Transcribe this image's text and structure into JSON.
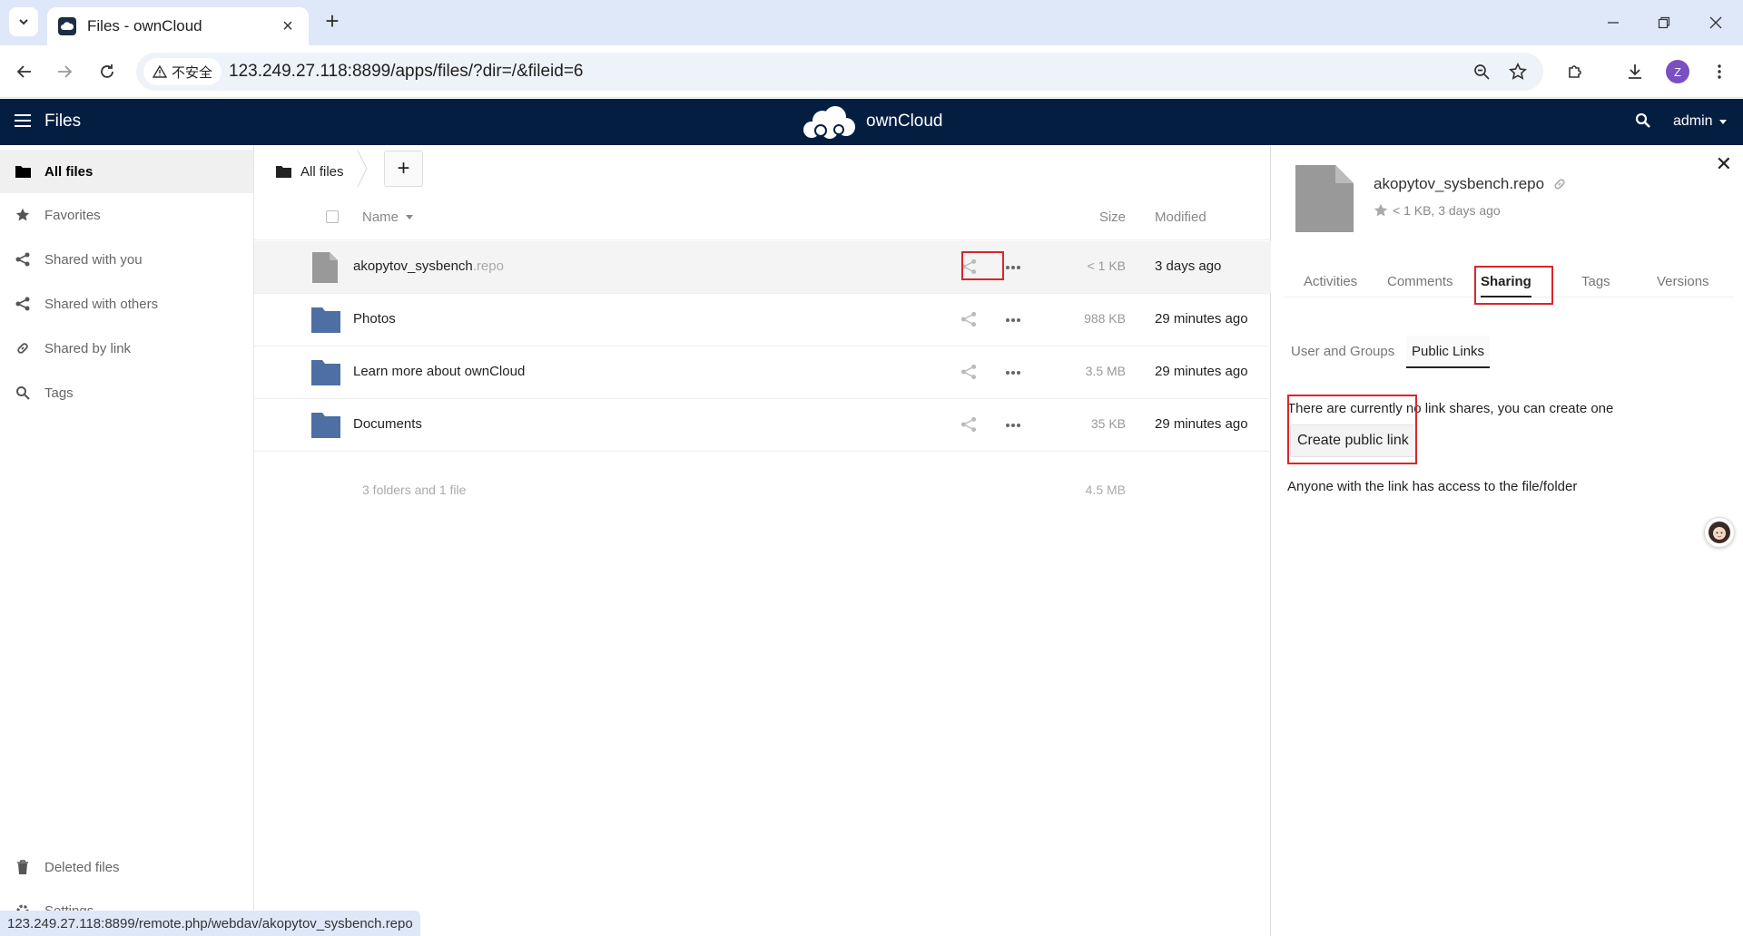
{
  "browser": {
    "tab_title": "Files - ownCloud",
    "security_label": "不安全",
    "url": "123.249.27.118:8899/apps/files/?dir=/&fileid=6",
    "profile_initial": "Z",
    "status_url": "123.249.27.118:8899/remote.php/webdav/akopytov_sysbench.repo"
  },
  "header": {
    "app_name": "Files",
    "brand": "ownCloud",
    "user": "admin"
  },
  "nav": {
    "items": [
      {
        "label": "All files",
        "icon": "folder-icon",
        "active": true
      },
      {
        "label": "Favorites",
        "icon": "star-icon"
      },
      {
        "label": "Shared with you",
        "icon": "share-icon"
      },
      {
        "label": "Shared with others",
        "icon": "share-icon"
      },
      {
        "label": "Shared by link",
        "icon": "link-icon"
      },
      {
        "label": "Tags",
        "icon": "search-icon"
      }
    ],
    "deleted_files": "Deleted files",
    "settings": "Settings"
  },
  "files": {
    "breadcrumb": "All files",
    "columns": {
      "name": "Name",
      "size": "Size",
      "modified": "Modified"
    },
    "rows": [
      {
        "name": "akopytov_sysbench",
        "ext": ".repo",
        "type": "file",
        "size": "< 1 KB",
        "modified": "3 days ago"
      },
      {
        "name": "Photos",
        "ext": "",
        "type": "folder",
        "size": "988 KB",
        "modified": "29 minutes ago"
      },
      {
        "name": "Learn more about ownCloud",
        "ext": "",
        "type": "folder",
        "size": "3.5 MB",
        "modified": "29 minutes ago"
      },
      {
        "name": "Documents",
        "ext": "",
        "type": "folder",
        "size": "35 KB",
        "modified": "29 minutes ago"
      }
    ],
    "summary_text": "3 folders and 1 file",
    "summary_size": "4.5 MB"
  },
  "details": {
    "filename": "akopytov_sysbench.repo",
    "meta": "< 1 KB, 3 days ago",
    "tabs": [
      "Activities",
      "Comments",
      "Sharing",
      "Tags",
      "Versions"
    ],
    "active_tab": "Sharing",
    "sub_tabs": [
      "User and Groups",
      "Public Links"
    ],
    "active_sub_tab": "Public Links",
    "no_links_text": "There are currently no link shares, you can create one",
    "create_button": "Create public link",
    "anyone_text": "Anyone with the link has access to the file/folder"
  },
  "colors": {
    "header_bg": "#041e42",
    "folder": "#4d6fa3",
    "highlight": "#d9262b"
  }
}
